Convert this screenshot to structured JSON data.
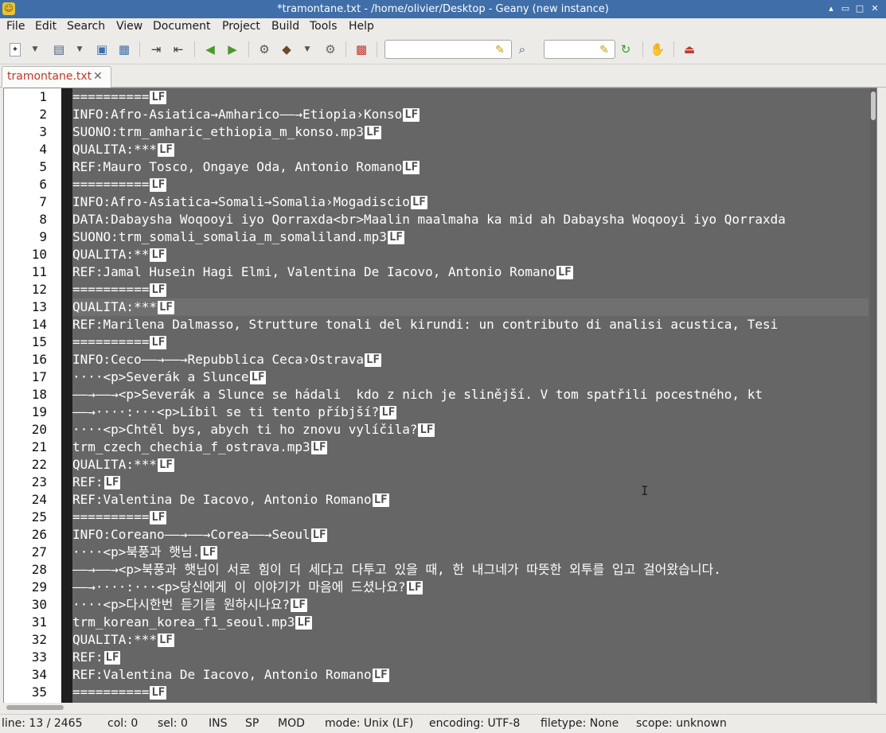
{
  "window": {
    "title": "*tramontane.txt - /home/olivier/Desktop - Geany (new instance)",
    "controls": [
      "▴",
      "▭",
      "□",
      "✕"
    ]
  },
  "menu": [
    "File",
    "Edit",
    "Search",
    "View",
    "Document",
    "Project",
    "Build",
    "Tools",
    "Help"
  ],
  "toolbar": {
    "search_value": "",
    "goto_value": ""
  },
  "tabs": [
    {
      "label": "tramontane.txt",
      "close": "✕"
    }
  ],
  "editor": {
    "eol_marker": "LF",
    "current_line": 13,
    "lines": [
      {
        "n": "1",
        "text": "==========",
        "eol": "LF"
      },
      {
        "n": "2",
        "text": "INFO:Afro-Asiatica→Amharico——→Etiopia›Konso",
        "eol": "LF"
      },
      {
        "n": "3",
        "text": "SUONO:trm_amharic_ethiopia_m_konso.mp3",
        "eol": "LF"
      },
      {
        "n": "4",
        "text": "QUALITA:***",
        "eol": "LF"
      },
      {
        "n": "5",
        "text": "REF:Mauro Tosco, Ongaye Oda, Antonio Romano",
        "eol": "LF"
      },
      {
        "n": "6",
        "text": "==========",
        "eol": "LF"
      },
      {
        "n": "7",
        "text": "INFO:Afro-Asiatica→Somali→Somalia›Mogadiscio",
        "eol": "LF"
      },
      {
        "n": "8",
        "text": "DATA:Dabaysha Woqooyi iyo Qorraxda<br>Maalin maalmaha ka mid ah Dabaysha Woqooyi iyo Qorraxda",
        "eol": ""
      },
      {
        "n": "9",
        "text": "SUONO:trm_somali_somalia_m_somaliland.mp3",
        "eol": "LF"
      },
      {
        "n": "10",
        "text": "QUALITA:**",
        "eol": "LF"
      },
      {
        "n": "11",
        "text": "REF:Jamal Husein Hagi Elmi, Valentina De Iacovo, Antonio Romano",
        "eol": "LF"
      },
      {
        "n": "12",
        "text": "==========",
        "eol": "LF"
      },
      {
        "n": "13",
        "text": "QUALITA:***",
        "eol": "LF"
      },
      {
        "n": "14",
        "text": "REF:Marilena Dalmasso, Strutture tonali del kirundi: un contributo di analisi acustica, Tesi",
        "eol": ""
      },
      {
        "n": "15",
        "text": "==========",
        "eol": "LF"
      },
      {
        "n": "16",
        "text": "INFO:Ceco——→——→Repubblica Ceca›Ostrava",
        "eol": "LF"
      },
      {
        "n": "17",
        "text": "····<p>Severák a Slunce",
        "eol": "LF"
      },
      {
        "n": "18",
        "text": "——→——→<p>Severák a Slunce se hádali  kdo z nich je slinější. V tom spatřili pocestného, kt",
        "eol": ""
      },
      {
        "n": "19",
        "text": "——→····:···<p>Líbil se ti tento příbjší?",
        "eol": "LF"
      },
      {
        "n": "20",
        "text": "····<p>Chtěl bys, abych ti ho znovu vylíčila?",
        "eol": "LF"
      },
      {
        "n": "21",
        "text": "trm_czech_chechia_f_ostrava.mp3",
        "eol": "LF"
      },
      {
        "n": "22",
        "text": "QUALITA:***",
        "eol": "LF"
      },
      {
        "n": "23",
        "text": "REF:",
        "eol": "LF"
      },
      {
        "n": "24",
        "text": "REF:Valentina De Iacovo, Antonio Romano",
        "eol": "LF"
      },
      {
        "n": "25",
        "text": "==========",
        "eol": "LF"
      },
      {
        "n": "26",
        "text": "INFO:Coreano——→——→Corea——→Seoul",
        "eol": "LF"
      },
      {
        "n": "27",
        "text": "····<p>북풍과 햇님.",
        "eol": "LF"
      },
      {
        "n": "28",
        "text": "——→——→<p>북풍과 햇님이 서로 힘이 더 세다고 다투고 있을 때, 한 내그네가 따뜻한 외투를 입고 걸어왔습니다.",
        "eol": ""
      },
      {
        "n": "29",
        "text": "——→····:···<p>당신에게 이 이야기가 마음에 드셨나요?",
        "eol": "LF"
      },
      {
        "n": "30",
        "text": "····<p>다시한번 듣기를 원하시나요?",
        "eol": "LF"
      },
      {
        "n": "31",
        "text": "trm_korean_korea_f1_seoul.mp3",
        "eol": "LF"
      },
      {
        "n": "32",
        "text": "QUALITA:***",
        "eol": "LF"
      },
      {
        "n": "33",
        "text": "REF:",
        "eol": "LF"
      },
      {
        "n": "34",
        "text": "REF:Valentina De Iacovo, Antonio Romano",
        "eol": "LF"
      },
      {
        "n": "35",
        "text": "==========",
        "eol": "LF"
      }
    ]
  },
  "status": {
    "line": "line: 13 / 2465",
    "col": "col: 0",
    "sel": "sel: 0",
    "ins": "INS",
    "sp": "SP",
    "mod": "MOD",
    "mode": "mode: Unix (LF)",
    "encoding": "encoding: UTF-8",
    "filetype": "filetype: None",
    "scope": "scope: unknown"
  }
}
